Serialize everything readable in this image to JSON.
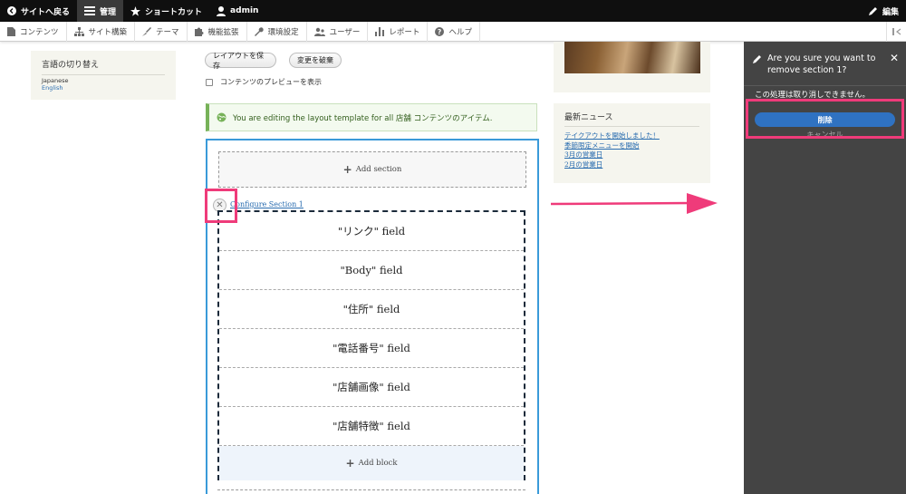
{
  "toolbar_top": {
    "back_label": "サイトへ戻る",
    "manage_label": "管理",
    "shortcuts_label": "ショートカット",
    "user_label": "admin",
    "edit_label": "編集"
  },
  "toolbar_menu": {
    "items": [
      {
        "label": "コンテンツ",
        "icon": "file-icon"
      },
      {
        "label": "サイト構築",
        "icon": "structure-icon"
      },
      {
        "label": "テーマ",
        "icon": "brush-icon"
      },
      {
        "label": "機能拡張",
        "icon": "puzzle-icon"
      },
      {
        "label": "環境設定",
        "icon": "wrench-icon"
      },
      {
        "label": "ユーザー",
        "icon": "people-icon"
      },
      {
        "label": "レポート",
        "icon": "bar-chart-icon"
      },
      {
        "label": "ヘルプ",
        "icon": "help-icon"
      }
    ]
  },
  "language_switcher": {
    "title": "言語の切り替え",
    "items": [
      "Japanese",
      "English"
    ]
  },
  "layout_builder": {
    "save_label": "レイアウトを保存",
    "discard_label": "変更を破棄",
    "preview_label": "コンテンツのプレビューを表示",
    "message": "You are editing the layout template for all 店舗 コンテンツのアイテム.",
    "add_section_label": "Add section",
    "configure_section_label": "Configure Section 1",
    "fields": [
      "\"リンク\" field",
      "\"Body\" field",
      "\"住所\" field",
      "\"電話番号\" field",
      "\"店舗画像\" field",
      "\"店舗特徴\" field"
    ],
    "add_block_label": "Add block"
  },
  "news": {
    "title": "最新ニュース",
    "items": [
      "テイクアウトを開始しました！",
      "季節限定メニューを開始",
      "3月の営業日",
      "2月の営業日"
    ]
  },
  "dialog": {
    "title": "Are you sure you want to remove section 1?",
    "message": "この処理は取り消しできません。",
    "delete_label": "削除",
    "cancel_label": "キャンセル"
  },
  "colors": {
    "highlight": "#ef3b7a",
    "primary_button": "#2f72c2",
    "outline": "#3a9ad9"
  }
}
